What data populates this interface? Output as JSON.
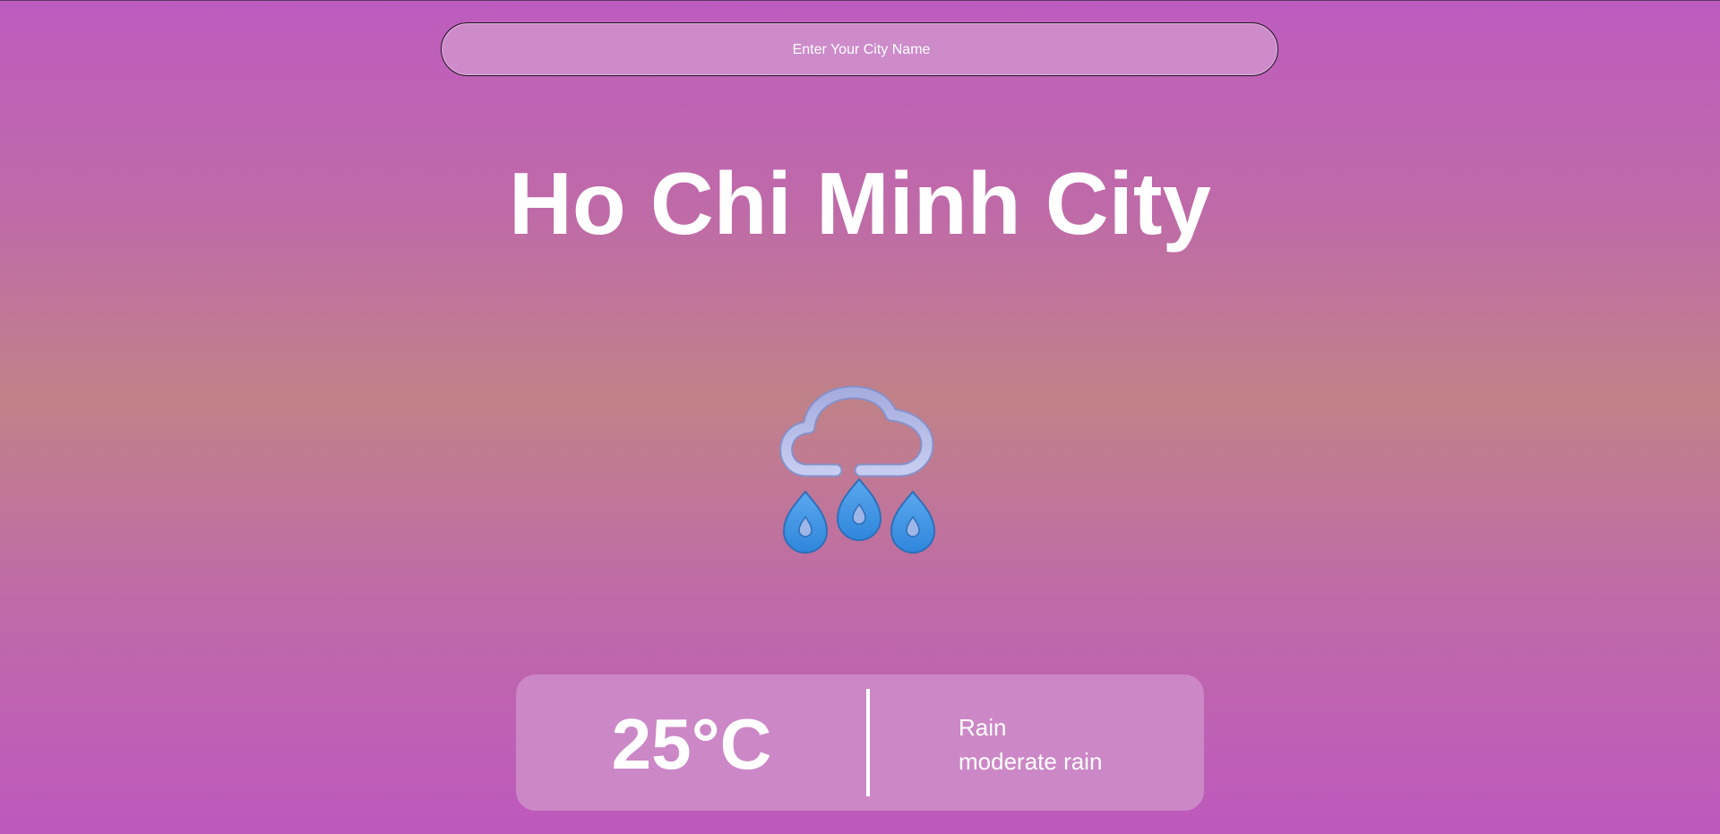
{
  "search": {
    "placeholder": "Enter Your City Name",
    "value": ""
  },
  "location": {
    "city": "Ho Chi Minh City"
  },
  "weather": {
    "icon": "rain-cloud-icon",
    "temperature": "25°C",
    "main": "Rain",
    "description": "moderate rain"
  },
  "colors": {
    "cloud": "#b3bde8",
    "drops": "#3d96e8"
  }
}
